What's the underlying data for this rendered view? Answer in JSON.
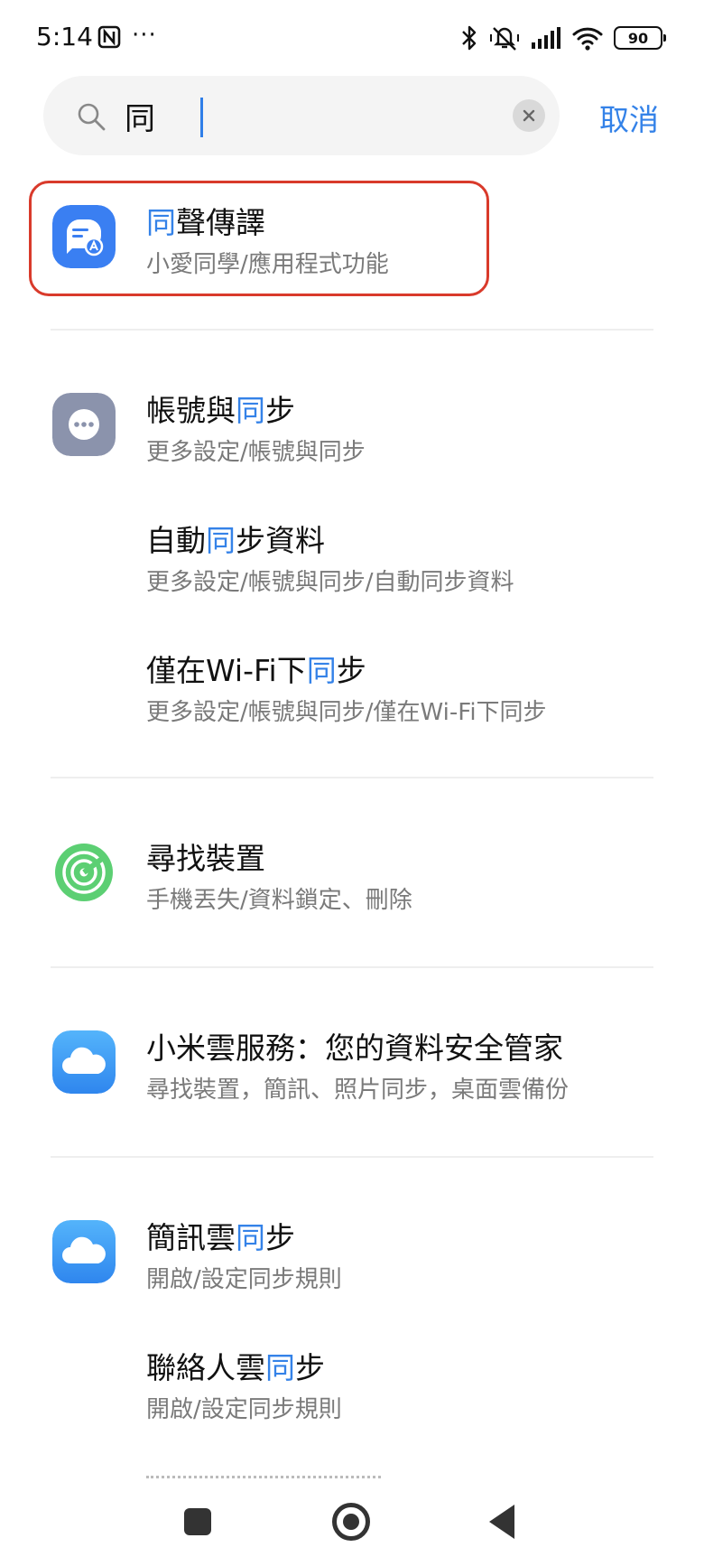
{
  "status_bar": {
    "time": "5:14",
    "nfc_icon": "nfc-icon",
    "more": "···",
    "icons": [
      "bluetooth-icon",
      "mute-vibrate-icon",
      "signal-icon",
      "wifi-icon"
    ],
    "battery": "90"
  },
  "search": {
    "query": "同",
    "clear_icon": "close-icon",
    "cancel_label": "取消"
  },
  "results": [
    {
      "icon": "translate-icon",
      "icon_color": "#3a7ff2",
      "title_pre": "",
      "title_hl": "同",
      "title_post": "聲傳譯",
      "subtitle": "小愛同學/應用程式功能"
    },
    {
      "icon": "more-circle-icon",
      "icon_color": "#8b93ac",
      "title_pre": "帳號與",
      "title_hl": "同",
      "title_post": "步",
      "subtitle": "更多設定/帳號與同步"
    },
    {
      "icon": "",
      "title_pre": "自動",
      "title_hl": "同",
      "title_post": "步資料",
      "subtitle": "更多設定/帳號與同步/自動同步資料"
    },
    {
      "icon": "",
      "title_pre": "僅在Wi-Fi下",
      "title_hl": "同",
      "title_post": "步",
      "subtitle": "更多設定/帳號與同步/僅在Wi-Fi下同步"
    },
    {
      "icon": "find-device-icon",
      "icon_color": "#5ccf73",
      "title_pre": "尋找裝置",
      "title_hl": "",
      "title_post": "",
      "subtitle": "手機丟失/資料鎖定、刪除"
    },
    {
      "icon": "cloud-icon",
      "icon_color": "#3d9cf3",
      "title_pre": "小米雲服務：您的資料安全管家",
      "title_hl": "",
      "title_post": "",
      "subtitle": "尋找裝置，簡訊、照片同步，桌面雲備份"
    },
    {
      "icon": "cloud-icon",
      "icon_color": "#3d9cf3",
      "title_pre": "簡訊雲",
      "title_hl": "同",
      "title_post": "步",
      "subtitle": "開啟/設定同步規則"
    },
    {
      "icon": "",
      "title_pre": "聯絡人雲",
      "title_hl": "同",
      "title_post": "步",
      "subtitle": "開啟/設定同步規則"
    }
  ],
  "nav": {
    "recents_icon": "recents-icon",
    "home_icon": "home-icon",
    "back_icon": "back-icon"
  },
  "colors": {
    "accent": "#3482e8",
    "highlight_frame": "#d93a2b"
  }
}
